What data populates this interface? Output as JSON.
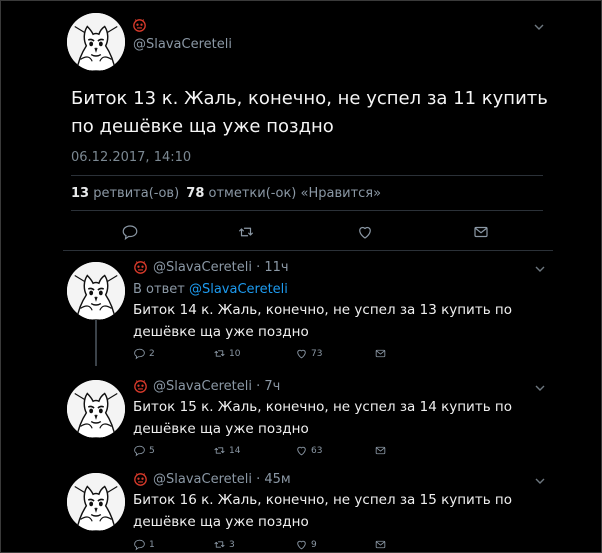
{
  "main": {
    "handle": "@SlavaCereteli",
    "text": "Биток 13 к. Жаль, конечно, не успел за 11 купить по дешёвке ща уже поздно",
    "timestamp": "06.12.2017, 14:10",
    "retweets_count": "13",
    "retweets_label": "ретвита(-ов)",
    "likes_count": "78",
    "likes_label": "отметки(-ок) «Нравится»",
    "actions": [
      "reply-icon",
      "retweet-icon",
      "like-icon",
      "message-icon"
    ]
  },
  "replies": [
    {
      "handle": "@SlavaCereteli",
      "time": "11ч",
      "in_reply_prefix": "В ответ",
      "in_reply_handle": "@SlavaCereteli",
      "text": "Биток 14 к. Жаль, конечно, не успел за 13 купить по дешёвке ща уже поздно",
      "replies": "2",
      "retweets": "10",
      "likes": "73"
    },
    {
      "handle": "@SlavaCereteli",
      "time": "7ч",
      "text": "Биток 15 к. Жаль, конечно, не успел за 14 купить по дешёвке ща уже поздно",
      "replies": "5",
      "retweets": "14",
      "likes": "63"
    },
    {
      "handle": "@SlavaCereteli",
      "time": "45м",
      "text": "Биток 16 к. Жаль, конечно, не успел за 15 купить по дешёвке ща уже поздно",
      "replies": "1",
      "retweets": "3",
      "likes": "9"
    }
  ],
  "colors": {
    "background": "#000000",
    "link": "#1d9bf0",
    "muted": "#8b98a5",
    "badge": "#d93a2b"
  }
}
